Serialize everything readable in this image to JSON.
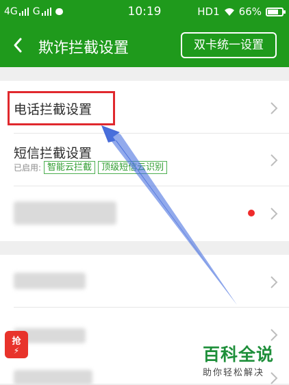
{
  "status_bar": {
    "sim1": "4G",
    "sim2": "G",
    "time": "10:19",
    "hd": "HD1",
    "battery": "66%"
  },
  "app_bar": {
    "title": "欺诈拦截设置",
    "dual_sim_button": "双卡统一设置"
  },
  "settings": {
    "items": [
      {
        "label": "电话拦截设置"
      },
      {
        "label": "短信拦截设置",
        "enabled_prefix": "已启用:",
        "tags": [
          "智能云拦截",
          "顶级短信云识别"
        ]
      }
    ]
  },
  "colors": {
    "header_green": "#1f9a1c",
    "highlight_red": "#e0282d",
    "arrow_blue": "#3e64d6",
    "tag_green": "#2e9c2e"
  },
  "watermark": {
    "main": "百科全说",
    "sub": "助你轻松解决"
  },
  "floating_icon": {
    "label": "抢"
  }
}
